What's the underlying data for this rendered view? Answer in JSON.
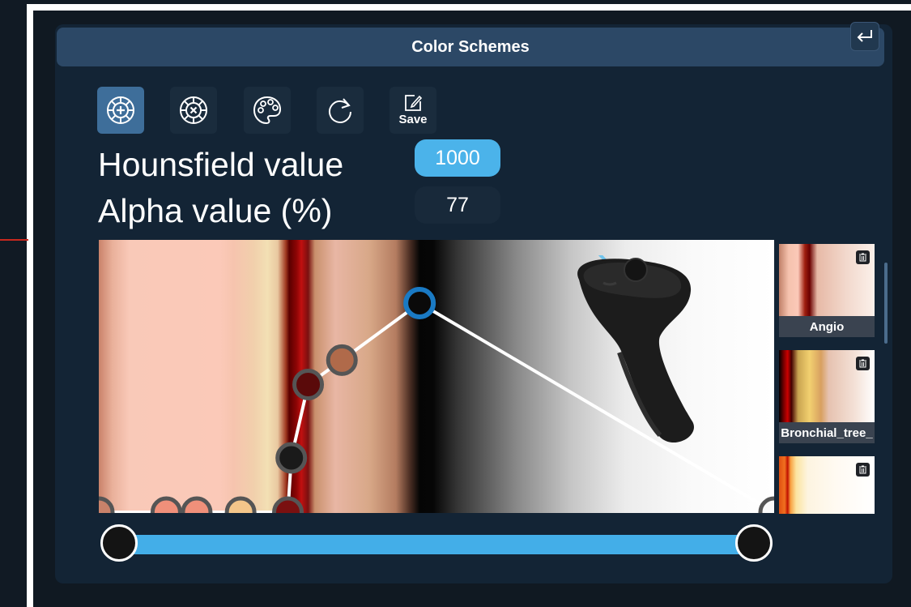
{
  "window": {
    "title": "Color Schemes"
  },
  "toolbar": {
    "tools": [
      {
        "icon": "add-point-icon",
        "active": true
      },
      {
        "icon": "remove-point-icon",
        "active": false
      },
      {
        "icon": "palette-icon",
        "active": false
      },
      {
        "icon": "reset-icon",
        "active": false
      },
      {
        "icon": "save-icon",
        "label": "Save",
        "active": false
      }
    ],
    "save_label": "Save"
  },
  "fields": {
    "hounsfield_label": "Hounsfield value",
    "hounsfield_value": "1000",
    "alpha_label": "Alpha value (%)",
    "alpha_value": "77"
  },
  "transfer_function": {
    "points": [
      {
        "x": 0.0,
        "y": 0.0,
        "color": "#c9826a"
      },
      {
        "x": 0.1,
        "y": 0.0,
        "color": "#f0907a"
      },
      {
        "x": 0.145,
        "y": 0.0,
        "color": "#f0907a"
      },
      {
        "x": 0.21,
        "y": 0.0,
        "color": "#f4c68a"
      },
      {
        "x": 0.28,
        "y": 0.0,
        "color": "#7a1010"
      },
      {
        "x": 0.285,
        "y": 0.2,
        "color": "#1a1a1a"
      },
      {
        "x": 0.31,
        "y": 0.47,
        "color": "#5a0a0a"
      },
      {
        "x": 0.36,
        "y": 0.56,
        "color": "#b06a4a"
      },
      {
        "x": 0.475,
        "y": 0.77,
        "color": "#0a0a0a",
        "selected": true
      },
      {
        "x": 1.0,
        "y": 0.0,
        "color": "#fafafa"
      }
    ],
    "selected_color": "#1a7ac4"
  },
  "range_slider": {
    "min": 0.0,
    "max": 1.0,
    "fill_color": "#43aee8"
  },
  "presets": [
    {
      "name": "Angio"
    },
    {
      "name": "Bronchial_tree_"
    },
    {
      "name": ""
    }
  ],
  "colors": {
    "accent": "#4bb3ea",
    "panel": "#132435",
    "title_bar": "#2c4866"
  }
}
